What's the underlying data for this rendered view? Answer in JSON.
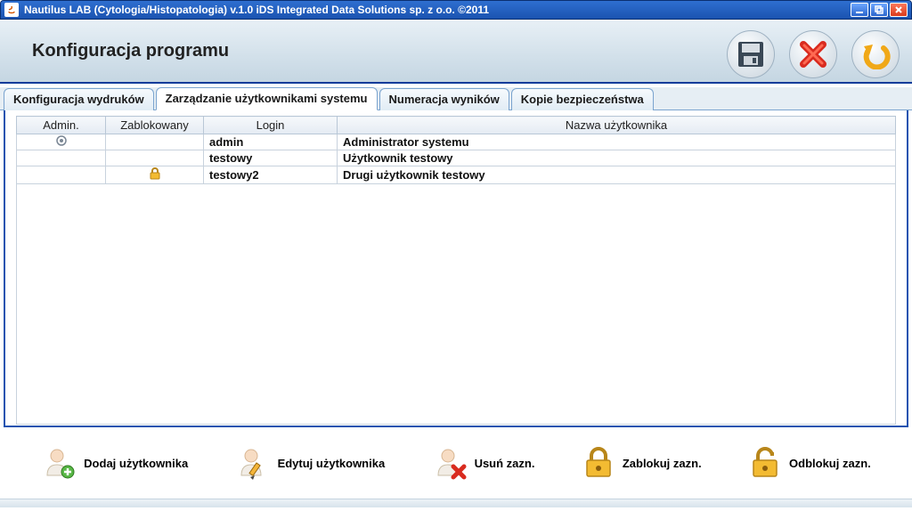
{
  "window": {
    "title": "Nautilus LAB (Cytologia/Histopatologia) v.1.0   iDS Integrated Data Solutions sp. z o.o. ©2011"
  },
  "header": {
    "title": "Konfiguracja programu"
  },
  "tabs": [
    {
      "label": "Konfiguracja wydruków",
      "active": false
    },
    {
      "label": "Zarządzanie użytkownikami systemu",
      "active": true
    },
    {
      "label": "Numeracja wyników",
      "active": false
    },
    {
      "label": "Kopie bezpieczeństwa",
      "active": false
    }
  ],
  "table": {
    "columns": {
      "admin": "Admin.",
      "locked": "Zablokowany",
      "login": "Login",
      "username": "Nazwa użytkownika"
    },
    "rows": [
      {
        "admin": true,
        "locked": false,
        "login": "admin",
        "username": "Administrator systemu"
      },
      {
        "admin": false,
        "locked": false,
        "login": "testowy",
        "username": "Użytkownik testowy"
      },
      {
        "admin": false,
        "locked": true,
        "login": "testowy2",
        "username": "Drugi użytkownik testowy"
      }
    ]
  },
  "actions": {
    "add": "Dodaj użytkownika",
    "edit": "Edytuj użytkownika",
    "delete": "Usuń zazn.",
    "lock": "Zablokuj zazn.",
    "unlock": "Odblokuj zazn."
  }
}
